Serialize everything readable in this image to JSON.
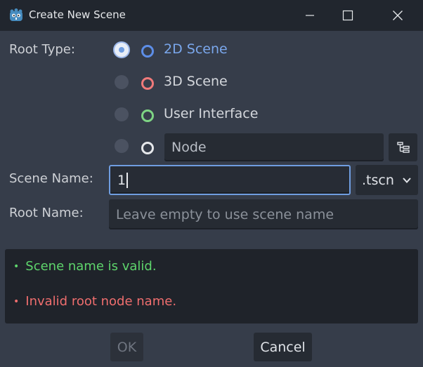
{
  "window": {
    "title": "Create New Scene"
  },
  "form": {
    "root_type_label": "Root Type:",
    "root_options": [
      {
        "label": "2D Scene",
        "selected": true,
        "ring_color": "#5d8ee8"
      },
      {
        "label": "3D Scene",
        "selected": false,
        "ring_color": "#f07a7a"
      },
      {
        "label": "User Interface",
        "selected": false,
        "ring_color": "#7ed484"
      },
      {
        "label": "Node",
        "selected": false,
        "ring_color": "#e6e8eb"
      }
    ],
    "scene_name_label": "Scene Name:",
    "scene_name_value": "1",
    "extension": ".tscn",
    "root_name_label": "Root Name:",
    "root_name_placeholder": "Leave empty to use scene name"
  },
  "messages": [
    {
      "text": "Scene name is valid.",
      "status": "valid"
    },
    {
      "text": "Invalid root node name.",
      "status": "error"
    }
  ],
  "buttons": {
    "ok": "OK",
    "cancel": "Cancel"
  },
  "colors": {
    "accent": "#6f9de0",
    "valid": "#5ed56c",
    "error": "#ef6e6e"
  }
}
